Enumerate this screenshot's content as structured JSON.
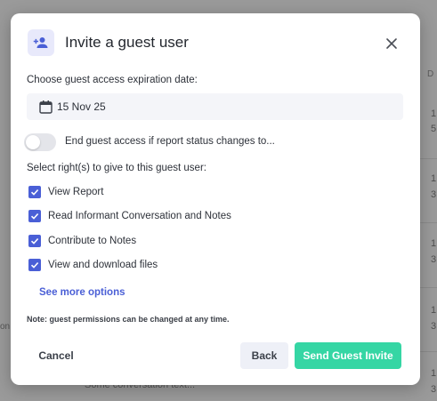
{
  "background": {
    "column_header": "D",
    "numbers": [
      "1",
      "5",
      "1",
      "3",
      "1",
      "3",
      "1",
      "3",
      "1",
      "3",
      "1"
    ],
    "left_fragment": "on",
    "bottom_fragment": "Some conversation text..."
  },
  "dialog": {
    "title": "Invite a guest user",
    "header_icon": "person-add-icon",
    "close_icon": "close-icon",
    "expiration_label": "Choose guest access expiration date:",
    "expiration_date": "15 Nov 25",
    "calendar_icon": "calendar-icon",
    "end_access_toggle": {
      "label": "End guest access if report status changes to...",
      "on": false
    },
    "rights_label": "Select right(s) to give to this guest user:",
    "rights": [
      {
        "label": "View Report",
        "checked": true
      },
      {
        "label": "Read Informant Conversation and Notes",
        "checked": true
      },
      {
        "label": "Contribute to Notes",
        "checked": true
      },
      {
        "label": "View and download files",
        "checked": true
      }
    ],
    "see_more": "See more options",
    "note": "Note: guest permissions can be changed at any time.",
    "buttons": {
      "cancel": "Cancel",
      "back": "Back",
      "send": "Send Guest Invite"
    }
  },
  "colors": {
    "accent": "#4a5fd6",
    "send_button": "#35d6a4",
    "overlay": "#9a9a9a"
  }
}
